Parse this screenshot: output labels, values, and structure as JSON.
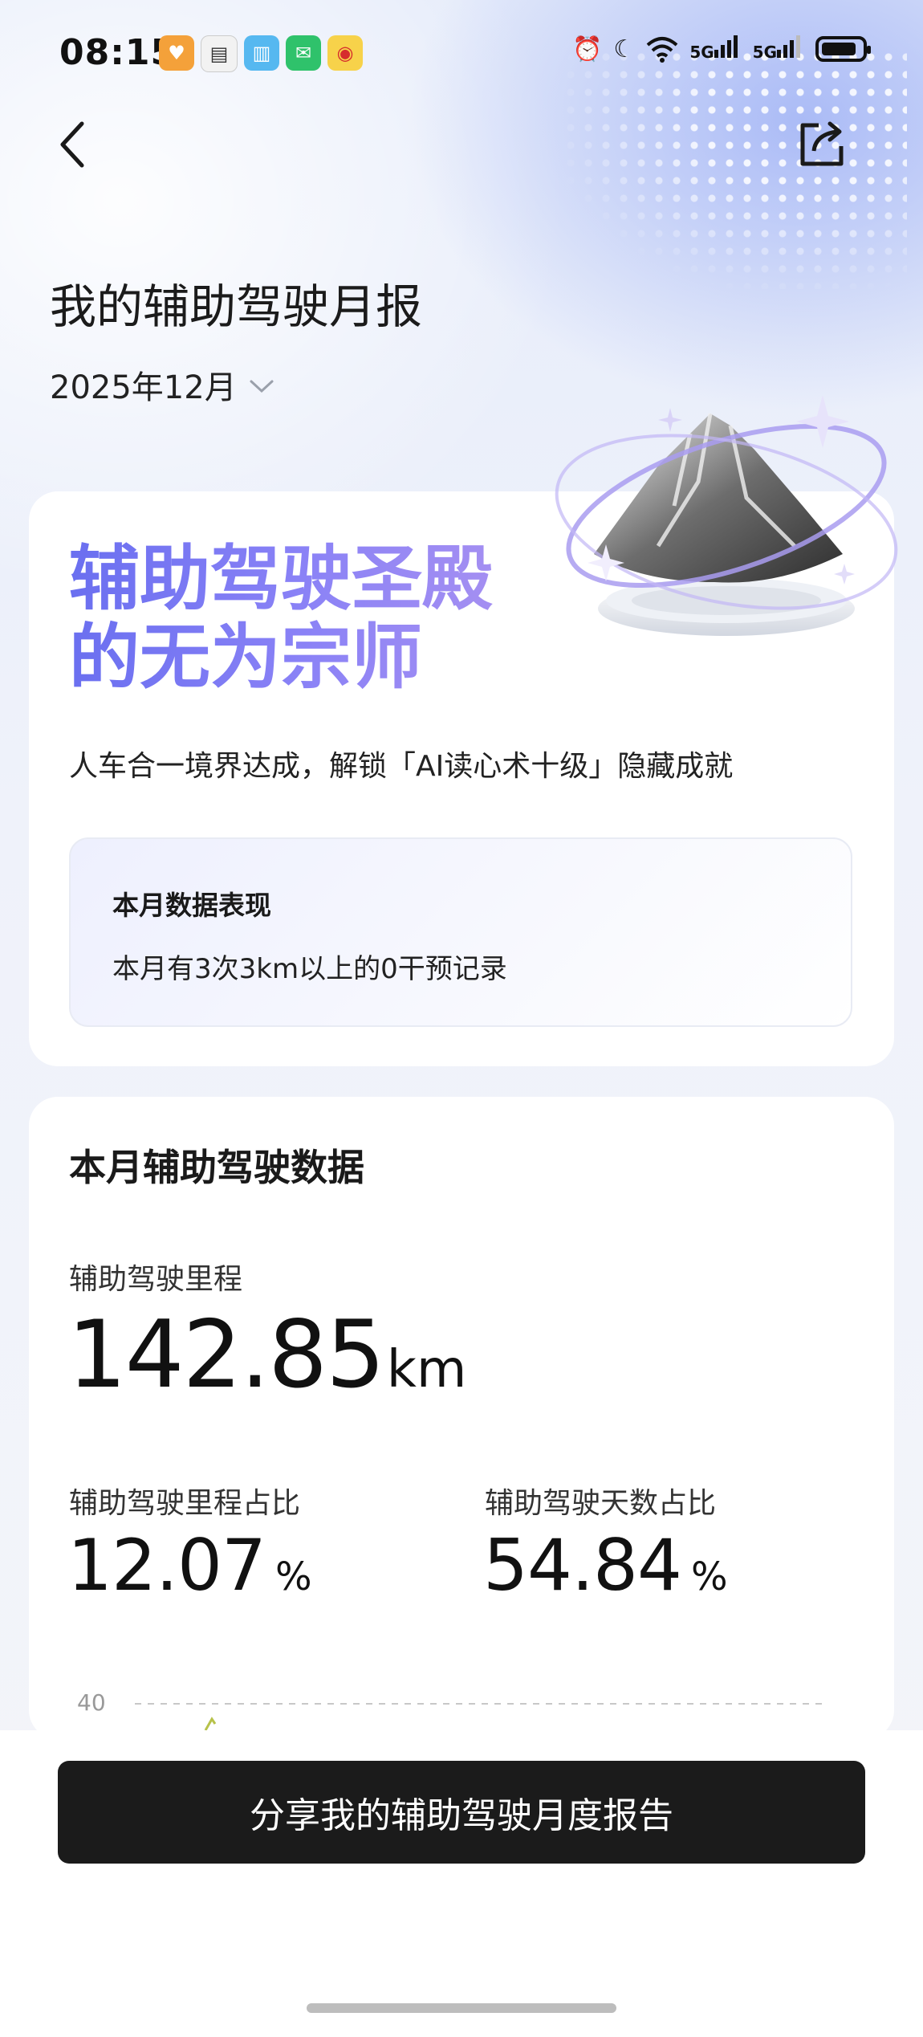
{
  "status_bar": {
    "time": "08:15",
    "app_icons": [
      "heart-app-icon",
      "notes-app-icon",
      "book-app-icon",
      "wechat-icon",
      "weibo-icon"
    ],
    "system_icons": [
      "alarm-icon",
      "moon-icon",
      "wifi-icon",
      "signal-5g-icon",
      "signal-5g-icon",
      "battery-icon"
    ],
    "network_labels": [
      "5G",
      "5G"
    ]
  },
  "header": {
    "title": "我的辅助驾驶月报",
    "month": "2025年12月"
  },
  "achievement_card": {
    "headline_line1": "辅助驾驶圣殿",
    "headline_line2": "的无为宗师",
    "description": "人车合一境界达成，解锁「AI读心术十级」隐藏成就",
    "performance_title": "本月数据表现",
    "performance_text": "本月有3次3km以上的0干预记录"
  },
  "stats_card": {
    "title": "本月辅助驾驶数据",
    "mileage_label": "辅助驾驶里程",
    "mileage_value": "142.85",
    "mileage_unit": "km",
    "mileage_ratio_label": "辅助驾驶里程占比",
    "mileage_ratio_value": "12.07",
    "days_ratio_label": "辅助驾驶天数占比",
    "days_ratio_value": "54.84",
    "percent_unit": "%"
  },
  "chart_data": {
    "type": "line",
    "y_tick_labels": [
      "40"
    ],
    "grid": true
  },
  "cta": {
    "label": "分享我的辅助驾驶月度报告"
  },
  "colors": {
    "headline_gradient_start": "#6a6ff0",
    "headline_gradient_end": "#a48ff2",
    "cta_background": "#1b1b1b",
    "chart_line": "#b7c24a"
  }
}
